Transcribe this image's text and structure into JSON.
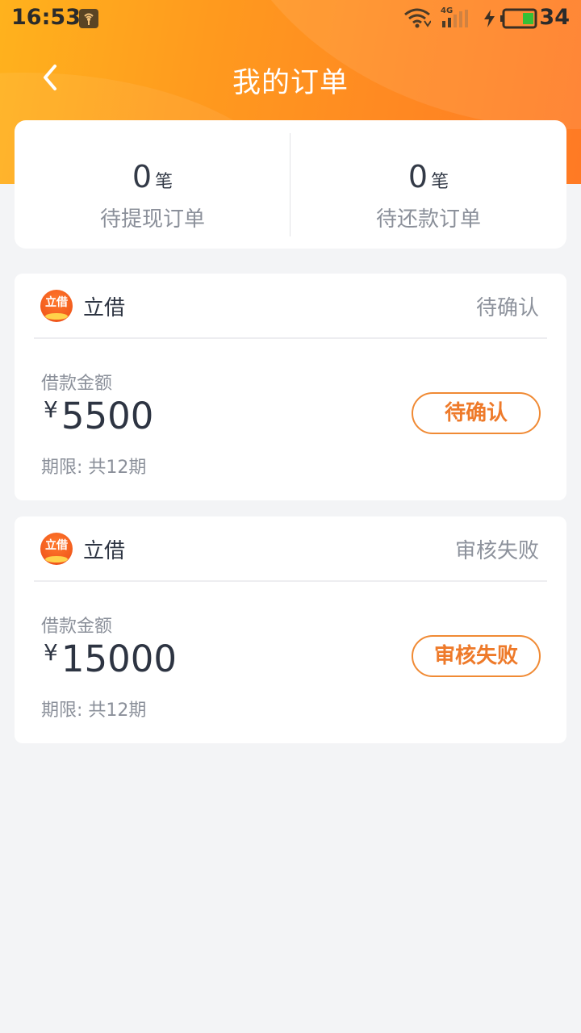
{
  "status_bar": {
    "time": "16:53",
    "network": "4G",
    "battery": "34"
  },
  "nav": {
    "title": "我的订单"
  },
  "summary": {
    "pending_withdraw": {
      "count": "0",
      "unit": "笔",
      "label": "待提现订单"
    },
    "pending_repay": {
      "count": "0",
      "unit": "笔",
      "label": "待还款订单"
    }
  },
  "orders": [
    {
      "lender": "立借",
      "logo_text": "立借",
      "status": "待确认",
      "amount_label": "借款金额",
      "currency": "¥",
      "amount": "5500",
      "term": "期限: 共12期",
      "button_label": "待确认"
    },
    {
      "lender": "立借",
      "logo_text": "立借",
      "status": "审核失败",
      "amount_label": "借款金额",
      "currency": "¥",
      "amount": "15000",
      "term": "期限: 共12期",
      "button_label": "审核失败"
    }
  ],
  "colors": {
    "header_start": "#ffb21d",
    "header_end": "#ff7a24",
    "accent": "#ee7a2a",
    "page_bg": "#f3f4f6"
  },
  "icons": {
    "back": "chevron-left-icon",
    "wifi": "wifi-icon",
    "signal": "signal-icon",
    "battery": "battery-icon",
    "charging": "charging-icon"
  }
}
